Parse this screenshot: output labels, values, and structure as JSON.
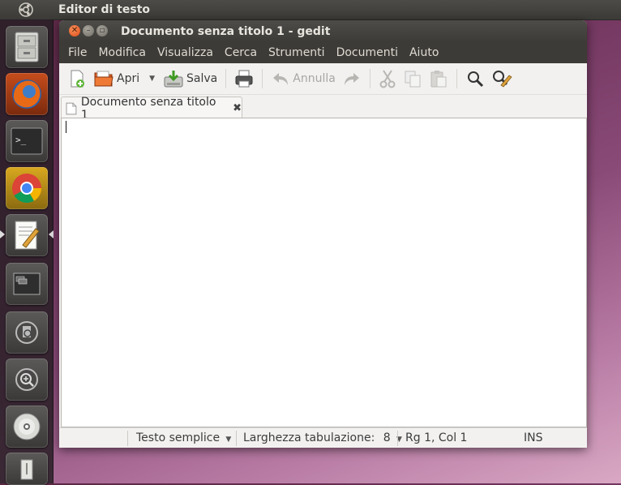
{
  "panel": {
    "app_title": "Editor di testo"
  },
  "launcher": {
    "items": [
      "file-cabinet",
      "firefox",
      "terminal",
      "chrome",
      "text-editor",
      "workspace-switcher",
      "lens",
      "zoom",
      "cd-drive",
      "usb"
    ]
  },
  "window": {
    "title": "Documento senza titolo 1 - gedit",
    "menu": [
      "File",
      "Modifica",
      "Visualizza",
      "Cerca",
      "Strumenti",
      "Documenti",
      "Aiuto"
    ],
    "toolbar": {
      "open_label": "Apri",
      "save_label": "Salva",
      "undo_label": "Annulla"
    },
    "tab": {
      "label": "Documento senza titolo 1"
    },
    "editor": {
      "content": ""
    },
    "status": {
      "language": "Testo semplice",
      "tab_width_label": "Larghezza tabulazione:",
      "tab_width_value": "8",
      "position": "Rg 1, Col 1",
      "mode": "INS"
    }
  },
  "colors": {
    "panel": "#3c3b37",
    "close_button": "#df4a16",
    "editor_bg": "#ffffff"
  }
}
